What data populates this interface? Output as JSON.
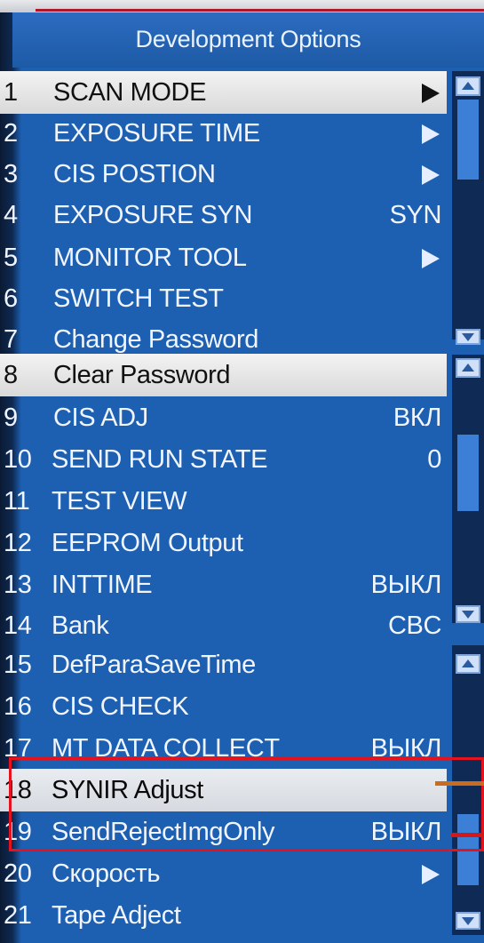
{
  "title": "Development Options",
  "menu": [
    {
      "num": "1",
      "label": "SCAN MODE",
      "value": "",
      "arrow": true
    },
    {
      "num": "2",
      "label": "EXPOSURE TIME",
      "value": "",
      "arrow": true
    },
    {
      "num": "3",
      "label": "CIS POSTION",
      "value": "",
      "arrow": true
    },
    {
      "num": "4",
      "label": "EXPOSURE SYN",
      "value": "SYN",
      "arrow": false
    },
    {
      "num": "5",
      "label": "MONITOR TOOL",
      "value": "",
      "arrow": true
    },
    {
      "num": "6",
      "label": "SWITCH TEST",
      "value": "",
      "arrow": false
    },
    {
      "num": "7",
      "label": "Change Password",
      "value": "",
      "arrow": false
    },
    {
      "num": "8",
      "label": "Clear Password",
      "value": "",
      "arrow": false
    },
    {
      "num": "9",
      "label": "CIS ADJ",
      "value": "ВКЛ",
      "arrow": false
    },
    {
      "num": "10",
      "label": "SEND RUN STATE",
      "value": "0",
      "arrow": false
    },
    {
      "num": "11",
      "label": "TEST VIEW",
      "value": "",
      "arrow": false
    },
    {
      "num": "12",
      "label": "EEPROM Output",
      "value": "",
      "arrow": false
    },
    {
      "num": "13",
      "label": "INTTIME",
      "value": "ВЫКЛ",
      "arrow": false
    },
    {
      "num": "14",
      "label": "Bank",
      "value": "CBC",
      "arrow": false
    },
    {
      "num": "15",
      "label": "DefParaSaveTime",
      "value": "",
      "arrow": false
    },
    {
      "num": "16",
      "label": "CIS CHECK",
      "value": "",
      "arrow": false
    },
    {
      "num": "17",
      "label": "MT DATA COLLECT",
      "value": "ВЫКЛ",
      "arrow": false
    },
    {
      "num": "18",
      "label": "SYNIR Adjust",
      "value": "",
      "arrow": false
    },
    {
      "num": "19",
      "label": "SendRejectImgOnly",
      "value": "ВЫКЛ",
      "arrow": false
    },
    {
      "num": "20",
      "label": "Скорость",
      "value": "",
      "arrow": true
    },
    {
      "num": "21",
      "label": "Tape Adject",
      "value": "",
      "arrow": false
    }
  ],
  "selected_items": [
    "1",
    "8"
  ],
  "annotated_items": [
    "18",
    "19"
  ],
  "colors": {
    "panel": "#1d5fb0",
    "highlight": "#e3131f",
    "selection": "#e8e8e8"
  }
}
